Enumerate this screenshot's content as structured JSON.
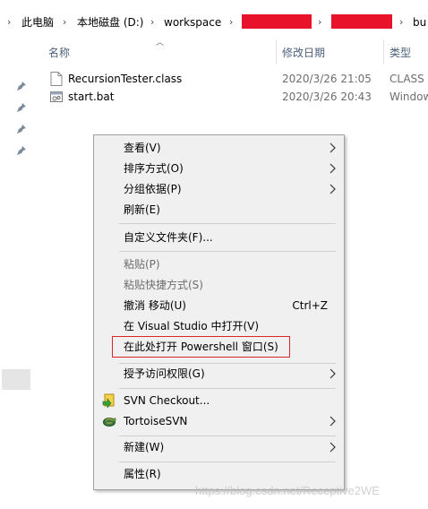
{
  "breadcrumb": {
    "items": [
      "此电脑",
      "本地磁盘 (D:)",
      "workspace"
    ],
    "last_partial": "bu",
    "redaction_color": "#e8132a"
  },
  "columns": {
    "name": "名称",
    "date": "修改日期",
    "type": "类型"
  },
  "files": [
    {
      "name": "RecursionTester.class",
      "date": "2020/3/26 21:05",
      "type": "CLASS 文",
      "icon": "class-file-icon"
    },
    {
      "name": "start.bat",
      "date": "2020/3/26 20:43",
      "type": "Window",
      "icon": "bat-file-icon"
    }
  ],
  "context_menu": {
    "view": "查看(V)",
    "sort": "排序方式(O)",
    "group": "分组依据(P)",
    "refresh": "刷新(E)",
    "customize": "自定义文件夹(F)...",
    "paste": "粘贴(P)",
    "paste_shortcut": "粘贴快捷方式(S)",
    "undo_move": "撤消 移动(U)",
    "undo_accel": "Ctrl+Z",
    "open_vs": "在 Visual Studio 中打开(V)",
    "open_powershell": "在此处打开 Powershell 窗口(S)",
    "give_access": "授予访问权限(G)",
    "svn_checkout": "SVN Checkout...",
    "tortoise_svn": "TortoiseSVN",
    "new": "新建(W)",
    "properties": "属性(R)"
  },
  "highlight_color": "#d9262b",
  "watermark": "https://blog.csdn.net/Receptive2WE"
}
